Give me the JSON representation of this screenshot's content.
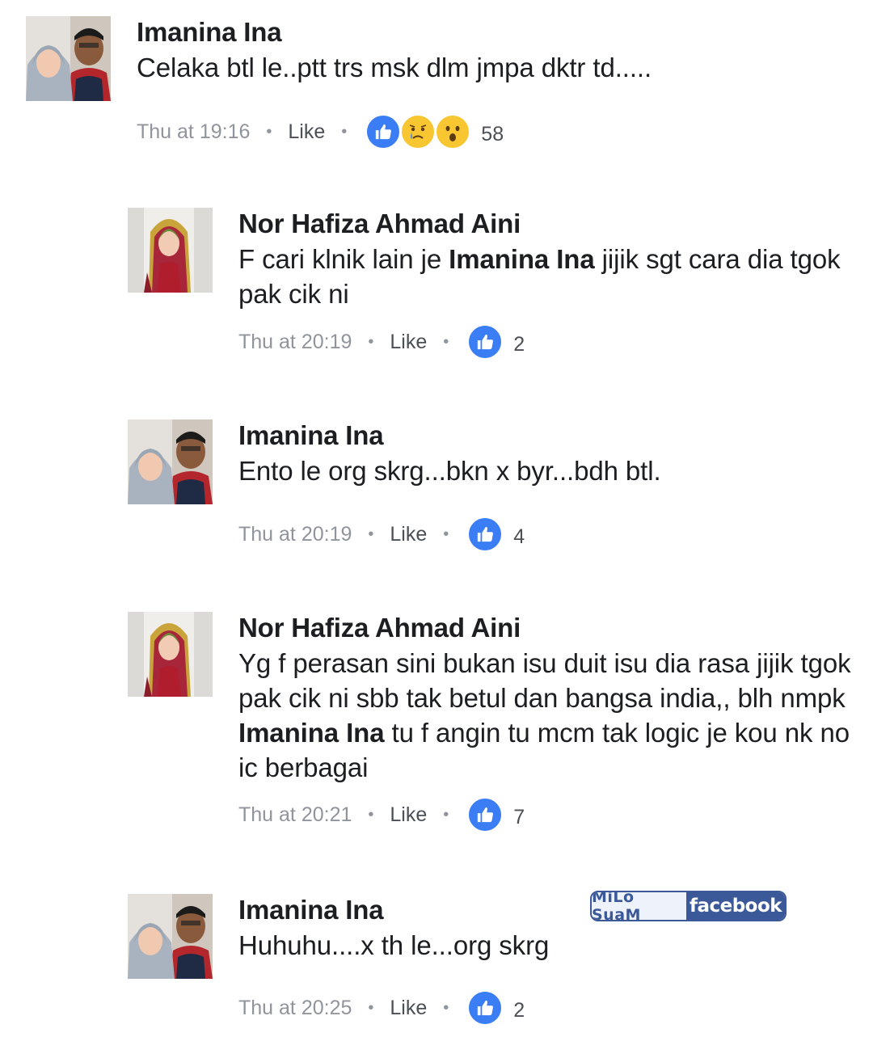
{
  "comments": [
    {
      "author": "Imanina Ina",
      "avatar": "couple-photo",
      "text_parts": [
        "Celaka btl le..ptt trs msk dlm jmpa dktr td....."
      ],
      "time": "Thu at 19:16",
      "like_label": "Like",
      "reactions": [
        "like",
        "sad",
        "wow"
      ],
      "reaction_count": "58"
    },
    {
      "author": "Nor Hafiza Ahmad Aini",
      "avatar": "hijab-portrait",
      "text_parts": [
        "F cari klnik lain je ",
        "Imanina Ina",
        " jijik sgt cara dia tgok pak cik ni"
      ],
      "time": "Thu at 20:19",
      "like_label": "Like",
      "reactions": [
        "like"
      ],
      "reaction_count": "2"
    },
    {
      "author": "Imanina Ina",
      "avatar": "couple-photo",
      "text_parts": [
        "Ento le org skrg...bkn x byr...bdh btl."
      ],
      "time": "Thu at 20:19",
      "like_label": "Like",
      "reactions": [
        "like"
      ],
      "reaction_count": "4"
    },
    {
      "author": "Nor Hafiza Ahmad Aini",
      "avatar": "hijab-portrait",
      "text_parts": [
        "Yg f perasan sini bukan isu duit isu dia rasa jijik tgok pak cik ni sbb tak betul dan bangsa india,, blh nmpk ",
        "Imanina Ina",
        " tu f angin tu mcm tak logic je kou nk no ic berbagai"
      ],
      "time": "Thu at 20:21",
      "like_label": "Like",
      "reactions": [
        "like"
      ],
      "reaction_count": "7"
    },
    {
      "author": "Imanina Ina",
      "avatar": "couple-photo",
      "text_parts": [
        "Huhuhu....x th le...org skrg"
      ],
      "time": "Thu at 20:25",
      "like_label": "Like",
      "reactions": [
        "like"
      ],
      "reaction_count": "2"
    }
  ],
  "watermark": {
    "left_text": "MiLo SuaM",
    "right_text": "facebook"
  },
  "colors": {
    "like_blue": "#3b7df5",
    "meta_gray": "#90949c",
    "facebook_blue": "#3b5998"
  }
}
